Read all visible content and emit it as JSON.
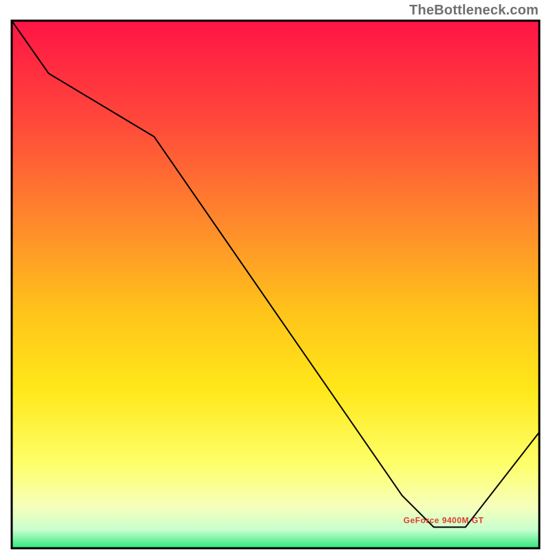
{
  "attribution": "TheBottleneck.com",
  "chart_data": {
    "type": "line",
    "title": "",
    "xlabel": "",
    "ylabel": "",
    "xlim": [
      0,
      100
    ],
    "ylim": [
      0,
      100
    ],
    "gradient_stops": [
      {
        "offset": 0,
        "color": "#ff1445"
      },
      {
        "offset": 0.2,
        "color": "#ff4b3a"
      },
      {
        "offset": 0.4,
        "color": "#ff8f2a"
      },
      {
        "offset": 0.55,
        "color": "#ffc31a"
      },
      {
        "offset": 0.7,
        "color": "#ffe81a"
      },
      {
        "offset": 0.84,
        "color": "#feff6a"
      },
      {
        "offset": 0.92,
        "color": "#f7ffba"
      },
      {
        "offset": 0.965,
        "color": "#c9ffcf"
      },
      {
        "offset": 1.0,
        "color": "#2ee87a"
      }
    ],
    "series": [
      {
        "name": "GeForce 9400M GT",
        "x": [
          0,
          7,
          27,
          74,
          80,
          86,
          100
        ],
        "values": [
          100,
          90,
          78,
          10,
          4,
          4,
          22
        ],
        "annotation_anchor_index": 5,
        "annotation_offset": {
          "dx": -90,
          "dy": -6
        }
      }
    ]
  }
}
